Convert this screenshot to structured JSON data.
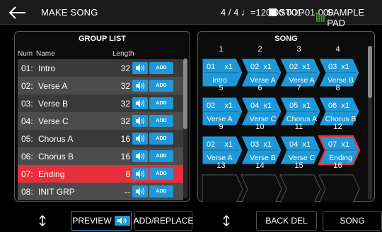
{
  "topbar": {
    "title": "MAKE SONG",
    "tempo_info": "4 / 4 ♩=120.00  001-01-000",
    "stop_label": "STOP",
    "pad_label": "SAMPLE PAD"
  },
  "group_list": {
    "title": "GROUP LIST",
    "col_num": "Num",
    "col_name": "Name",
    "col_length": "Length",
    "add_label": "ADD",
    "rows": [
      {
        "num": "01:",
        "name": "Intro",
        "length": "32"
      },
      {
        "num": "02:",
        "name": "Verse A",
        "length": "32"
      },
      {
        "num": "03:",
        "name": "Verse B",
        "length": "32"
      },
      {
        "num": "04:",
        "name": "Verse C",
        "length": "32"
      },
      {
        "num": "05:",
        "name": "Chorus A",
        "length": "16"
      },
      {
        "num": "06:",
        "name": "Chorus B",
        "length": "16"
      },
      {
        "num": "07:",
        "name": "Ending",
        "length": "8",
        "selected": true
      },
      {
        "num": "08:",
        "name": "INIT GRP",
        "length": "--"
      }
    ]
  },
  "song": {
    "title": "SONG",
    "slots": [
      {
        "index": "1",
        "grp": "01",
        "rep": "x1",
        "name": "Intro"
      },
      {
        "index": "2",
        "grp": "02",
        "rep": "x1",
        "name": "Verse A"
      },
      {
        "index": "3",
        "grp": "02",
        "rep": "x1",
        "name": "Verse A"
      },
      {
        "index": "4",
        "grp": "03",
        "rep": "x1",
        "name": "Verse B"
      },
      {
        "index": "5",
        "grp": "02",
        "rep": "x1",
        "name": "Verse A"
      },
      {
        "index": "6",
        "grp": "04",
        "rep": "x1",
        "name": "Verse C"
      },
      {
        "index": "7",
        "grp": "05",
        "rep": "x1",
        "name": "Chorus A"
      },
      {
        "index": "8",
        "grp": "06",
        "rep": "x1",
        "name": "Chorus B"
      },
      {
        "index": "9",
        "grp": "02",
        "rep": "x1",
        "name": "Verse A"
      },
      {
        "index": "10",
        "grp": "03",
        "rep": "x1",
        "name": "Verse B"
      },
      {
        "index": "11",
        "grp": "04",
        "rep": "x1",
        "name": "Verse C"
      },
      {
        "index": "12",
        "grp": "07",
        "rep": "x1",
        "name": "Ending",
        "selected": true
      },
      {
        "index": "13",
        "grp": "",
        "rep": "",
        "name": ""
      },
      {
        "index": "14",
        "grp": "",
        "rep": "",
        "name": ""
      },
      {
        "index": "15",
        "grp": "",
        "rep": "",
        "name": ""
      },
      {
        "index": "16",
        "grp": "",
        "rep": "",
        "name": ""
      }
    ]
  },
  "bottombar": {
    "preview_label": "PREVIEW",
    "add_replace_label": "ADD/REPLACE",
    "back_del_label": "BACK DEL",
    "song_label": "SONG"
  },
  "colors": {
    "accent_blue": "#1f98d8",
    "selected_red": "#e8303a",
    "sample_pad_green": "#55c43c"
  }
}
